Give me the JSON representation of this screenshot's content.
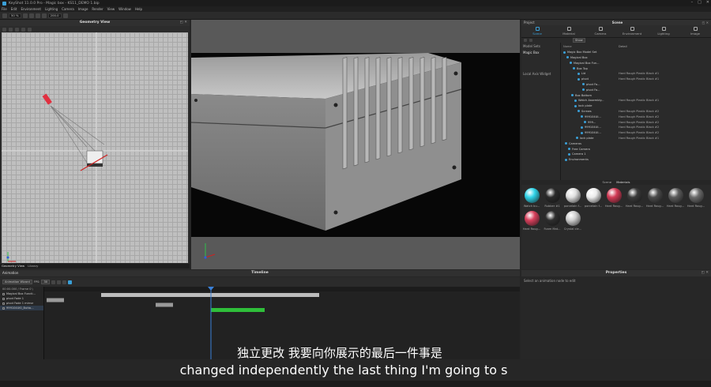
{
  "window": {
    "title": "KeyShot 11.0.0 Pro - Magic box - KS11_DEMO 1.bip"
  },
  "menu": [
    "File",
    "Edit",
    "Environment",
    "Lighting",
    "Camera",
    "Image",
    "Render",
    "View",
    "Window",
    "Help"
  ],
  "toolbar": {
    "zoom": "50 %",
    "value": "200.0"
  },
  "geometry_view": {
    "title": "Geometry View",
    "tabs": [
      "Geometry View",
      "Library"
    ]
  },
  "project": {
    "title": "Project",
    "scene_title": "Scene",
    "tabs": [
      "Scene",
      "Material",
      "Camera",
      "Environment",
      "Lighting",
      "Image"
    ],
    "show_label": "Show",
    "model_sets_header": "Model Sets",
    "model_set_item": "Magic Box",
    "local_axis": "Local Axis Widget",
    "tree_header_name": "Name",
    "tree_header_detail": "Detail",
    "tree": [
      {
        "name": "Magic Box Model Set",
        "detail": ""
      },
      {
        "name": "Magical Box",
        "detail": ""
      },
      {
        "name": "Magical Box Fun...",
        "detail": ""
      },
      {
        "name": "Box Top",
        "detail": ""
      },
      {
        "name": "Lid",
        "detail": "Hard Rough Plastic Black #1"
      },
      {
        "name": "pivot",
        "detail": "Hard Rough Plastic Black #1"
      },
      {
        "name": "pivot Fa...",
        "detail": ""
      },
      {
        "name": "pivot Fa...",
        "detail": ""
      },
      {
        "name": "Box Bottom",
        "detail": ""
      },
      {
        "name": "Watch Assembly...",
        "detail": "Hard Rough Plastic Black #1"
      },
      {
        "name": "lock plate",
        "detail": ""
      },
      {
        "name": "Screws",
        "detail": "Hard Rough Plastic Black #2"
      },
      {
        "name": "999104UI...",
        "detail": "Hard Rough Plastic Black #2"
      },
      {
        "name": "999...",
        "detail": "Hard Rough Plastic Black #2"
      },
      {
        "name": "999104UI...",
        "detail": "Hard Rough Plastic Black #2"
      },
      {
        "name": "999104UI...",
        "detail": "Hard Rough Plastic Black #2"
      },
      {
        "name": "lock plate",
        "detail": "Hard Rough Plastic Black #1"
      },
      {
        "name": "Cameras",
        "detail": ""
      },
      {
        "name": "Free Camera",
        "detail": ""
      },
      {
        "name": "Camera 1",
        "detail": ""
      },
      {
        "name": "Environments",
        "detail": ""
      }
    ],
    "bottom_tabs": [
      "Scene",
      "Materials"
    ],
    "materials": [
      {
        "label": "Watch bu...",
        "color": "#2fd3e8"
      },
      {
        "label": "Rubber #1",
        "color": "#2a2a2a"
      },
      {
        "label": "porcelain f...",
        "color": "#e0e0e0"
      },
      {
        "label": "porcelain f...",
        "color": "#ececec"
      },
      {
        "label": "Hard Roug...",
        "color": "#d23a55"
      },
      {
        "label": "Hard Roug...",
        "color": "#3a3a3a"
      },
      {
        "label": "Hard Roug...",
        "color": "#4a4a4a"
      },
      {
        "label": "Hard Roug...",
        "color": "#5a5a5a"
      },
      {
        "label": "Hard Roug...",
        "color": "#6a6a6a"
      },
      {
        "label": "Hard Roug...",
        "color": "#d8405c"
      },
      {
        "label": "Foam Mat...",
        "color": "#2e2e2e"
      },
      {
        "label": "Crystal cle...",
        "color": "#cfcfcf"
      }
    ]
  },
  "animation": {
    "title": "Animation",
    "timeline_title": "Timeline",
    "wizard": "Animation Wizard",
    "fps_label": "FPS:",
    "fps": "30",
    "time": "00:00.000 / Frame 0 \\",
    "tracks": [
      "Magical Box Functi...",
      "pivot Fade 1",
      "pivot Fade 1 mirror",
      "999104UI0_Butto..."
    ]
  },
  "properties": {
    "title": "Properties",
    "hint": "Select an animation node to edit"
  },
  "subtitles": {
    "cn": "独立更改 我要向你展示的最后一件事是",
    "en": "changed independently the last thing I'm going to s"
  }
}
